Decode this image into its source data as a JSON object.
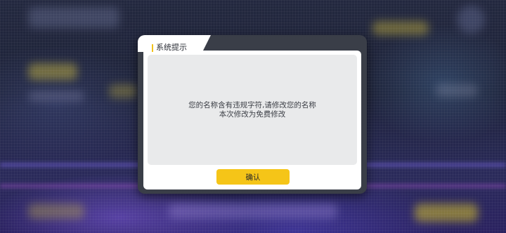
{
  "dialog": {
    "title": "系统提示",
    "message_lines": [
      "您的名称含有违规字符,请修改您的名称",
      "本次修改为免费修改"
    ],
    "confirm_label": "确认"
  },
  "colors": {
    "accent": "#f5c518",
    "dialog_frame": "#3a3e48",
    "message_bg": "#e9eaeb",
    "text": "#3b3e45"
  }
}
